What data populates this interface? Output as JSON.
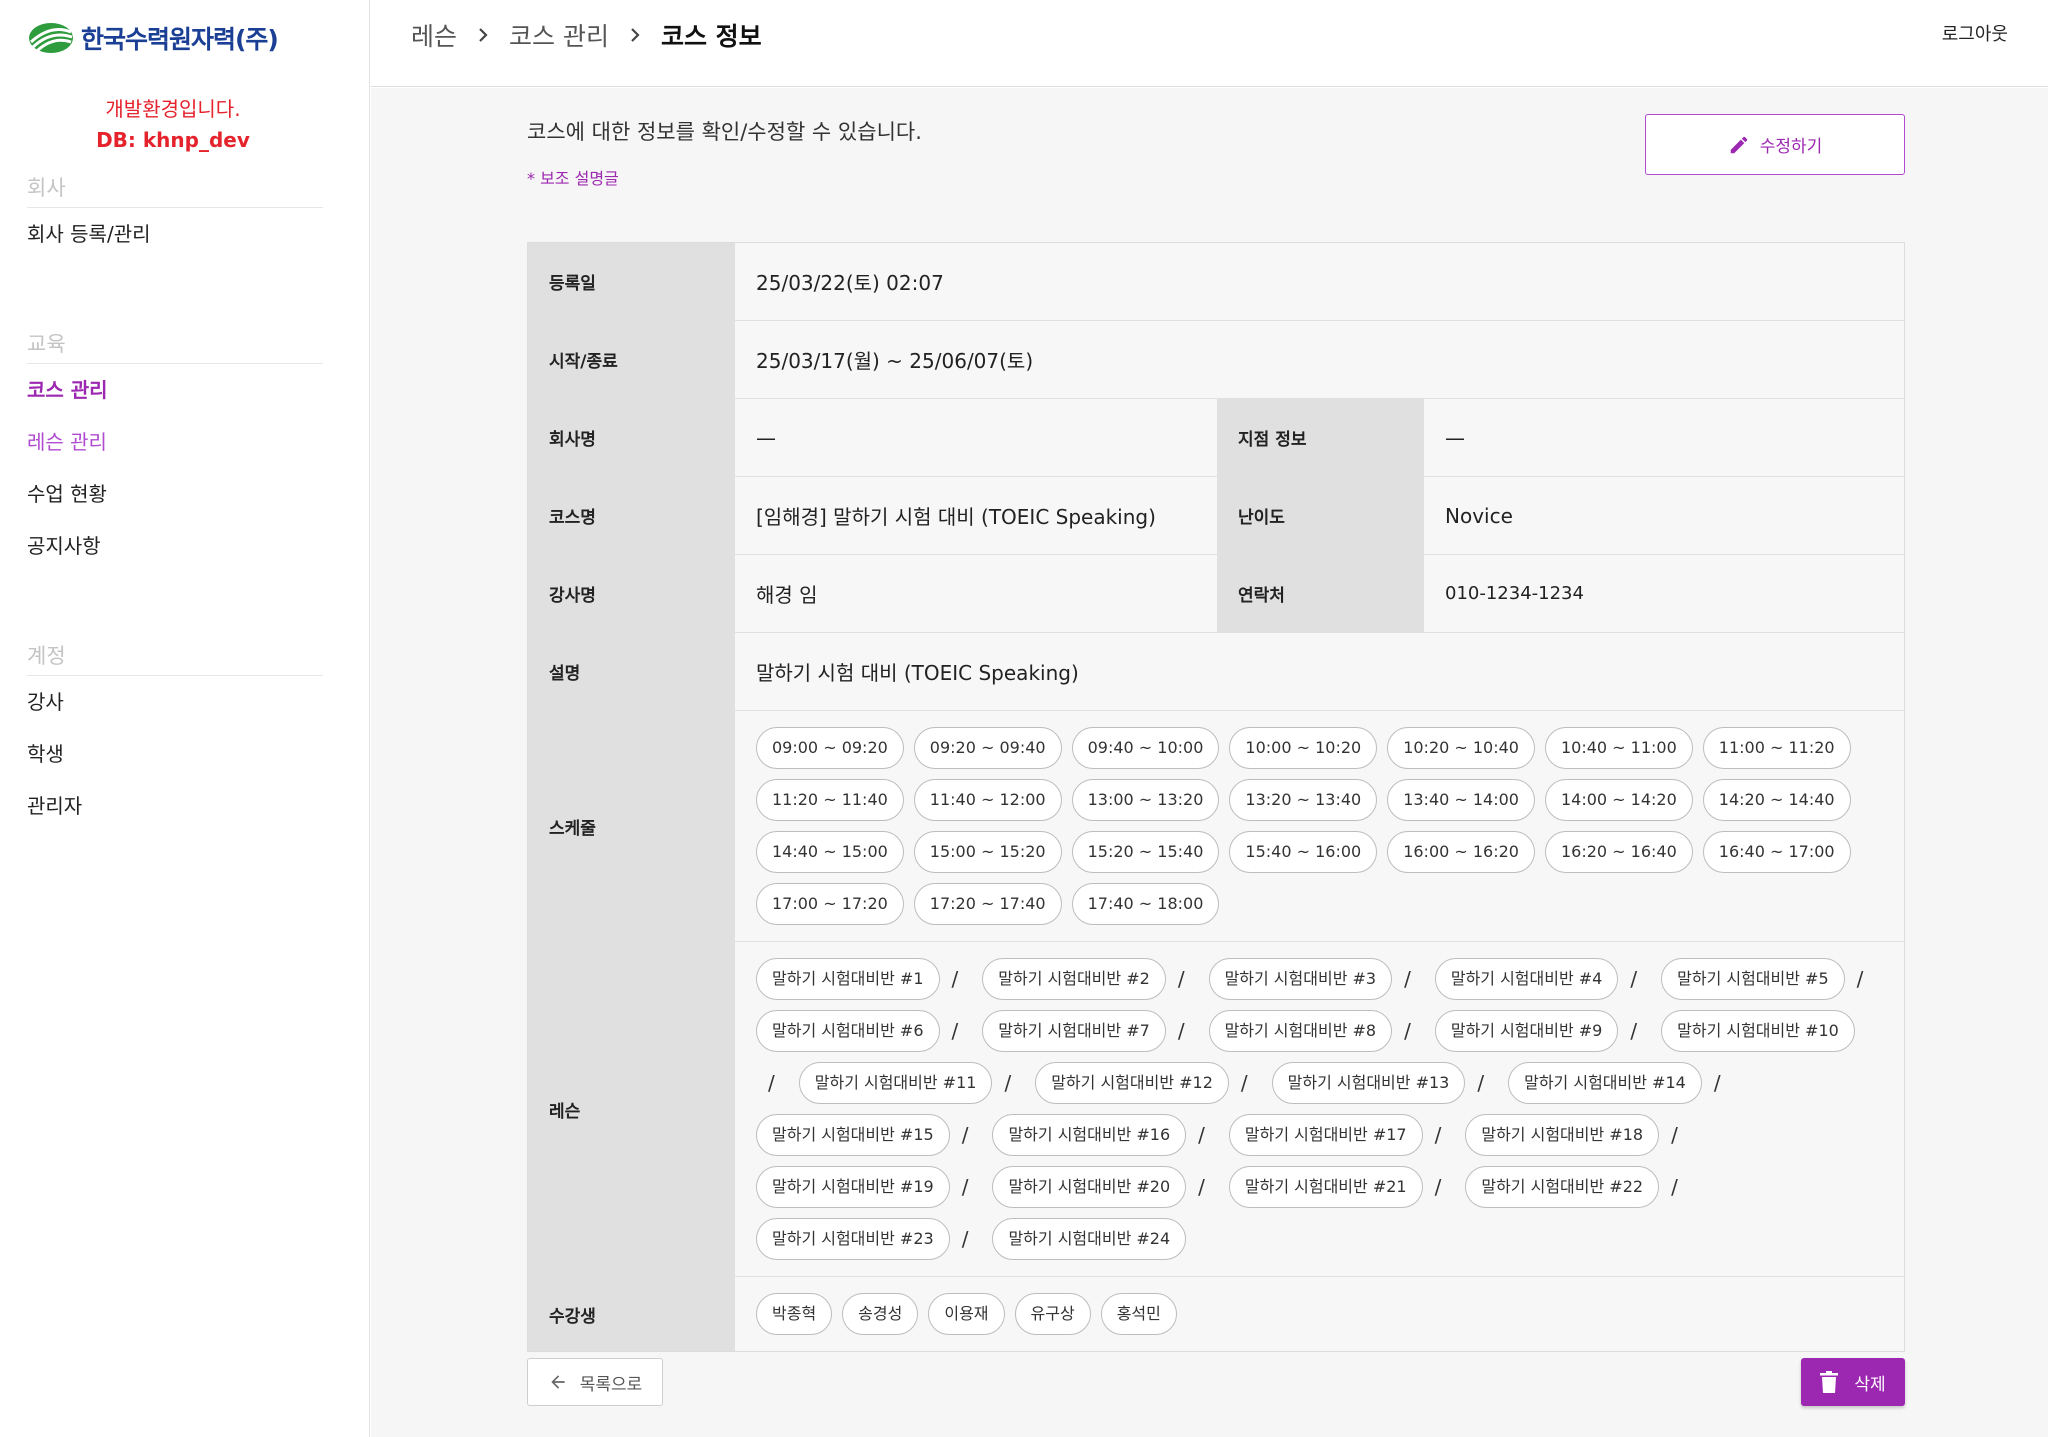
{
  "sidebar": {
    "logo_text": "한국수력원자력(주)",
    "env_notice": "개발환경입니다.",
    "db_notice": "DB: khnp_dev",
    "sections": [
      {
        "title": "회사",
        "items": [
          {
            "label": "회사 등록/관리",
            "state": "normal"
          }
        ]
      },
      {
        "title": "교육",
        "items": [
          {
            "label": "코스 관리",
            "state": "active"
          },
          {
            "label": "레슨 관리",
            "state": "sub-active"
          },
          {
            "label": "수업 현황",
            "state": "normal"
          },
          {
            "label": "공지사항",
            "state": "normal"
          }
        ]
      },
      {
        "title": "계정",
        "items": [
          {
            "label": "강사",
            "state": "normal"
          },
          {
            "label": "학생",
            "state": "normal"
          },
          {
            "label": "관리자",
            "state": "normal"
          }
        ]
      }
    ]
  },
  "header": {
    "breadcrumb": [
      "레슨",
      "코스 관리",
      "코스 정보"
    ],
    "logout_label": "로그아웃"
  },
  "main": {
    "description": "코스에 대한 정보를 확인/수정할 수 있습니다.",
    "sub_description": "* 보조 설명글",
    "edit_label": "수정하기",
    "back_label": "목록으로",
    "delete_label": "삭제"
  },
  "course": {
    "labels": {
      "registered": "등록일",
      "period": "시작/종료",
      "company": "회사명",
      "branch": "지점 정보",
      "course_name": "코스명",
      "level": "난이도",
      "instructor": "강사명",
      "contact": "연락처",
      "description": "설명",
      "schedule": "스케줄",
      "lessons": "레슨",
      "students": "수강생"
    },
    "registered": "25/03/22(토) 02:07",
    "period": "25/03/17(월) ~ 25/06/07(토)",
    "company": "—",
    "branch": "—",
    "course_name": "[임해경] 말하기 시험 대비 (TOEIC Speaking)",
    "level": "Novice",
    "instructor": "해경 임",
    "contact": "010-1234-1234",
    "description": "말하기 시험 대비 (TOEIC Speaking)",
    "schedule": [
      "09:00 ~ 09:20",
      "09:20 ~ 09:40",
      "09:40 ~ 10:00",
      "10:00 ~ 10:20",
      "10:20 ~ 10:40",
      "10:40 ~ 11:00",
      "11:00 ~ 11:20",
      "11:20 ~ 11:40",
      "11:40 ~ 12:00",
      "13:00 ~ 13:20",
      "13:20 ~ 13:40",
      "13:40 ~ 14:00",
      "14:00 ~ 14:20",
      "14:20 ~ 14:40",
      "14:40 ~ 15:00",
      "15:00 ~ 15:20",
      "15:20 ~ 15:40",
      "15:40 ~ 16:00",
      "16:00 ~ 16:20",
      "16:20 ~ 16:40",
      "16:40 ~ 17:00",
      "17:00 ~ 17:20",
      "17:20 ~ 17:40",
      "17:40 ~ 18:00"
    ],
    "lessons": [
      "말하기 시험대비반 #1",
      "말하기 시험대비반 #2",
      "말하기 시험대비반 #3",
      "말하기 시험대비반 #4",
      "말하기 시험대비반 #5",
      "말하기 시험대비반 #6",
      "말하기 시험대비반 #7",
      "말하기 시험대비반 #8",
      "말하기 시험대비반 #9",
      "말하기 시험대비반 #10",
      "말하기 시험대비반 #11",
      "말하기 시험대비반 #12",
      "말하기 시험대비반 #13",
      "말하기 시험대비반 #14",
      "말하기 시험대비반 #15",
      "말하기 시험대비반 #16",
      "말하기 시험대비반 #17",
      "말하기 시험대비반 #18",
      "말하기 시험대비반 #19",
      "말하기 시험대비반 #20",
      "말하기 시험대비반 #21",
      "말하기 시험대비반 #22",
      "말하기 시험대비반 #23",
      "말하기 시험대비반 #24"
    ],
    "lesson_separator": "/",
    "students": [
      "박종혁",
      "송경성",
      "이용재",
      "유구상",
      "홍석민"
    ]
  },
  "colors": {
    "accent": "#9c27b0",
    "env_notice": "#e5232d",
    "logo_blue": "#1a3f95",
    "logo_green": "#2e9b3d"
  },
  "icons": {
    "logo": "khnp-logo-icon",
    "breadcrumb_sep": "chevron-right-icon",
    "edit": "pencil-icon",
    "back": "arrow-left-icon",
    "delete": "trash-icon"
  }
}
